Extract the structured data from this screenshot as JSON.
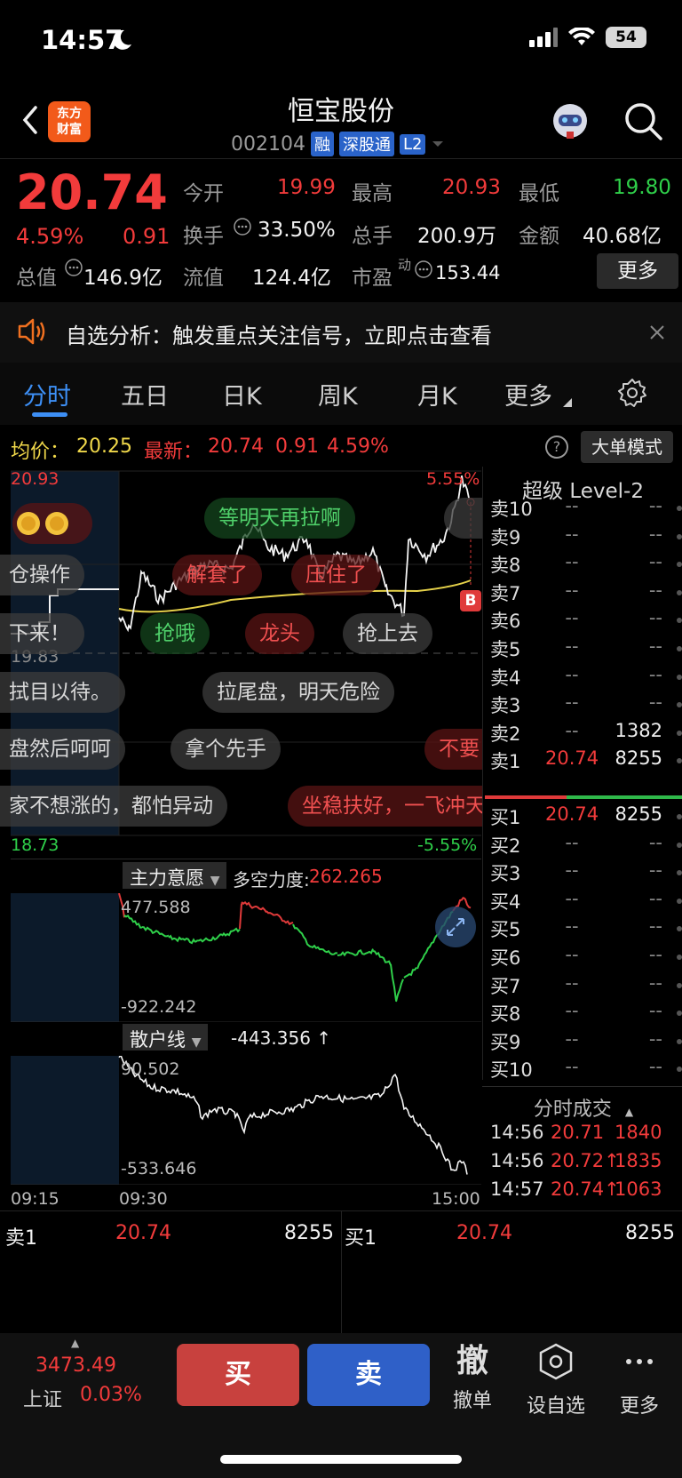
{
  "status_bar": {
    "time": "14:57",
    "battery": "54"
  },
  "header": {
    "logo_text_1": "东方",
    "logo_text_2": "财富",
    "stock_name": "恒宝股份",
    "stock_code": "002104",
    "tags": [
      "融",
      "深股通",
      "L2"
    ]
  },
  "quote": {
    "price": "20.74",
    "change_pct": "4.59%",
    "change": "0.91",
    "open_label": "今开",
    "open": "19.99",
    "high_label": "最高",
    "high": "20.93",
    "low_label": "最低",
    "low": "19.80",
    "turnover_label": "换手",
    "turnover": "33.50%",
    "volume_label": "总手",
    "volume": "200.9万",
    "amount_label": "金额",
    "amount": "40.68亿",
    "mktcap_label": "总值",
    "mktcap": "146.9亿",
    "float_label": "流值",
    "float": "124.4亿",
    "pe_label": "市盈",
    "pe_sup": "动",
    "pe": "153.44",
    "more_label": "更多"
  },
  "banner": {
    "text": "自选分析：触发重点关注信号，立即点击查看"
  },
  "tabs": [
    "分时",
    "五日",
    "日K",
    "周K",
    "月K",
    "更多"
  ],
  "avg_row": {
    "avg_label": "均价：",
    "avg": "20.25",
    "latest_label": "最新：",
    "latest": "20.74",
    "chg": "0.91",
    "pct": "4.59%",
    "bigorder_label": "大单模式",
    "help": "?"
  },
  "chart": {
    "y_top": "20.93",
    "y_mid": "19.83",
    "y_bottom": "18.73",
    "pct_top": "5.55%",
    "pct_bottom": "-5.55%",
    "marker_b": "B",
    "bubbles": [
      {
        "text": "等明天再拉啊",
        "style": "green"
      },
      {
        "text": "仓操作",
        "style": "gray"
      },
      {
        "text": "解套了",
        "style": "red"
      },
      {
        "text": "压住了",
        "style": "red"
      },
      {
        "text": "下来！",
        "style": "gray"
      },
      {
        "text": "抢哦",
        "style": "green"
      },
      {
        "text": "龙头",
        "style": "red"
      },
      {
        "text": "抢上去",
        "style": "gray"
      },
      {
        "text": "拭目以待。",
        "style": "gray"
      },
      {
        "text": "拉尾盘，明天危险",
        "style": "gray"
      },
      {
        "text": "盘然后呵呵",
        "style": "gray"
      },
      {
        "text": "拿个先手",
        "style": "gray"
      },
      {
        "text": "不要",
        "style": "red"
      },
      {
        "text": "家不想涨的，都怕异动",
        "style": "gray"
      },
      {
        "text": "坐稳扶好，一飞冲天",
        "style": "red"
      }
    ]
  },
  "chart_data": {
    "type": "line",
    "title": "",
    "x": [
      "09:15",
      "09:30",
      "15:00"
    ],
    "ylim": [
      18.73,
      20.93
    ],
    "series": [
      {
        "name": "",
        "values": []
      },
      {
        "name": "均价",
        "values": []
      }
    ]
  },
  "indicator1": {
    "name": "主力意愿",
    "label": "多空力度:",
    "value": "262.265",
    "y_top": "477.588",
    "y_bottom": "-922.242"
  },
  "indicator2": {
    "name": "散户线",
    "value": "-443.356 ↑",
    "y_top": "90.502",
    "y_bottom": "-533.646"
  },
  "time_axis": [
    "09:15",
    "09:30",
    "15:00"
  ],
  "orderbook": {
    "title": "超级 Level-2",
    "asks": [
      {
        "label": "卖10",
        "price": "--",
        "vol": "--"
      },
      {
        "label": "卖9",
        "price": "--",
        "vol": "--"
      },
      {
        "label": "卖8",
        "price": "--",
        "vol": "--"
      },
      {
        "label": "卖7",
        "price": "--",
        "vol": "--"
      },
      {
        "label": "卖6",
        "price": "--",
        "vol": "--"
      },
      {
        "label": "卖5",
        "price": "--",
        "vol": "--"
      },
      {
        "label": "卖4",
        "price": "--",
        "vol": "--"
      },
      {
        "label": "卖3",
        "price": "--",
        "vol": "--"
      },
      {
        "label": "卖2",
        "price": "--",
        "vol": "1382"
      },
      {
        "label": "卖1",
        "price": "20.74",
        "vol": "8255"
      }
    ],
    "bids": [
      {
        "label": "买1",
        "price": "20.74",
        "vol": "8255"
      },
      {
        "label": "买2",
        "price": "--",
        "vol": "--"
      },
      {
        "label": "买3",
        "price": "--",
        "vol": "--"
      },
      {
        "label": "买4",
        "price": "--",
        "vol": "--"
      },
      {
        "label": "买5",
        "price": "--",
        "vol": "--"
      },
      {
        "label": "买6",
        "price": "--",
        "vol": "--"
      },
      {
        "label": "买7",
        "price": "--",
        "vol": "--"
      },
      {
        "label": "买8",
        "price": "--",
        "vol": "--"
      },
      {
        "label": "买9",
        "price": "--",
        "vol": "--"
      },
      {
        "label": "买10",
        "price": "--",
        "vol": "--"
      }
    ]
  },
  "ticks": {
    "header": "分时成交",
    "rows": [
      {
        "time": "14:56",
        "price": "20.71",
        "vol": "1840"
      },
      {
        "time": "14:56",
        "price": "20.72↑",
        "vol": "1835"
      },
      {
        "time": "14:57",
        "price": "20.74↑",
        "vol": "1063"
      }
    ]
  },
  "bottom_quote": {
    "sell_label": "卖1",
    "sell_price": "20.74",
    "sell_vol": "8255",
    "buy_label": "买1",
    "buy_price": "20.74",
    "buy_vol": "8255"
  },
  "bottom_bar": {
    "index_value": "3473.49",
    "index_name": "上证",
    "index_pct": "0.03%",
    "buy": "买",
    "sell": "卖",
    "cancel_glyph": "撤",
    "cancel": "撤单",
    "add_watch": "设自选",
    "more": "更多"
  }
}
